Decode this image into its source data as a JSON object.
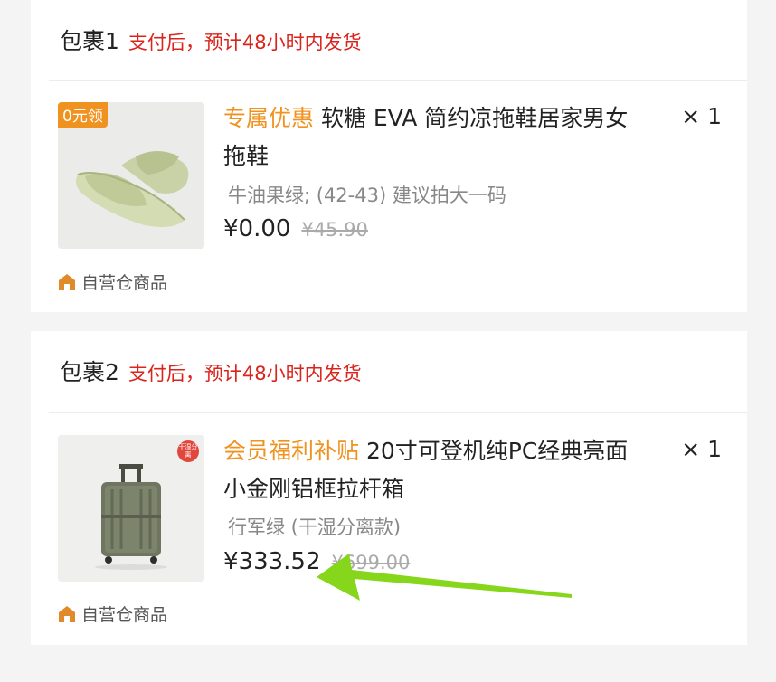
{
  "packages": [
    {
      "title": "包裹1",
      "shipping": "支付后，预计48小时内发货",
      "item": {
        "badge": "0元领",
        "promo": "专属优惠",
        "name": " 软糖 EVA 简约凉拖鞋居家男女拖鞋",
        "qty": "× 1",
        "variant": "牛油果绿; (42-43) 建议拍大一码",
        "price": "¥0.00",
        "original_price": "¥45.90",
        "image_icon": "slipper-image"
      },
      "store": "自营仓商品"
    },
    {
      "title": "包裹2",
      "shipping": "支付后，预计48小时内发货",
      "item": {
        "badge": "干湿分离",
        "promo": "会员福利补贴",
        "name": " 20寸可登机纯PC经典亮面小金刚铝框拉杆箱",
        "qty": "× 1",
        "variant": "行军绿 (干湿分离款)",
        "price": "¥333.52",
        "original_price": "¥699.00",
        "image_icon": "suitcase-image"
      },
      "store": "自营仓商品"
    }
  ],
  "colors": {
    "promo": "#f0921f",
    "shipping": "#d9251d",
    "arrow": "#86d61c"
  },
  "store_icon": "warehouse-icon",
  "annotation_icon": "green-arrow-icon"
}
